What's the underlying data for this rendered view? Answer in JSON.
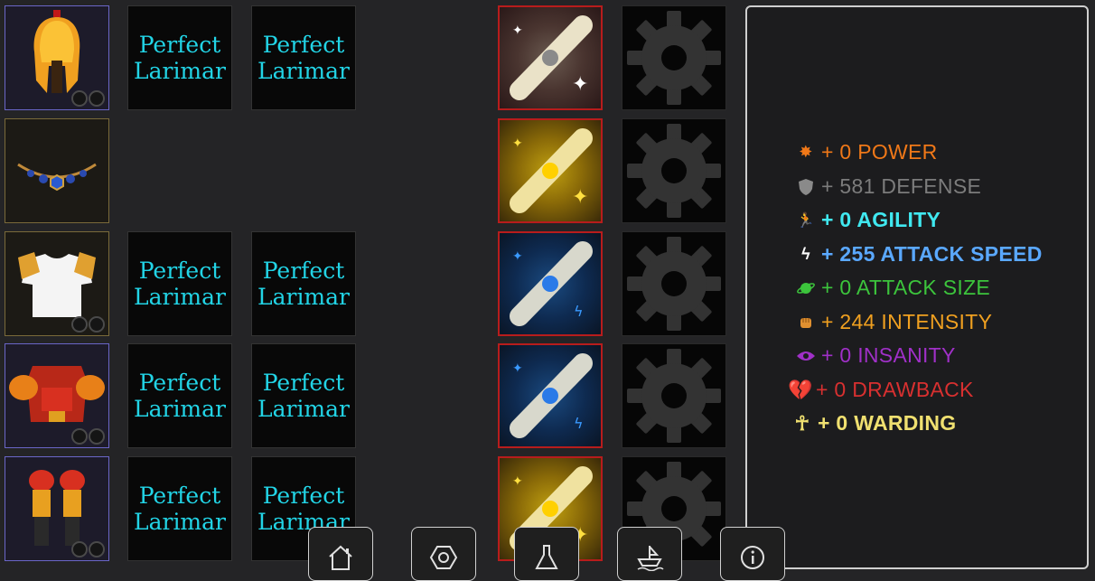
{
  "gear_rows": [
    {
      "item": "spartan-helmet",
      "gems": [
        "Perfect Larimar",
        "Perfect Larimar"
      ],
      "scroll": "silver"
    },
    {
      "item": "sapphire-necklace",
      "gems": [],
      "scroll": "gold"
    },
    {
      "item": "white-chest-tunic",
      "gems": [
        "Perfect Larimar",
        "Perfect Larimar"
      ],
      "scroll": "blue"
    },
    {
      "item": "red-gold-armor",
      "gems": [
        "Perfect Larimar",
        "Perfect Larimar"
      ],
      "scroll": "blue"
    },
    {
      "item": "red-gold-greaves",
      "gems": [
        "Perfect Larimar",
        "Perfect Larimar"
      ],
      "scroll": "gold"
    }
  ],
  "gem_labels": {
    "r0a": "Perfect Larimar",
    "r0b": "Perfect Larimar",
    "r2a": "Perfect Larimar",
    "r2b": "Perfect Larimar",
    "r3a": "Perfect Larimar",
    "r3b": "Perfect Larimar",
    "r4a": "Perfect Larimar",
    "r4b": "Perfect Larimar"
  },
  "stats": {
    "power": {
      "text": "+ 0 POWER",
      "icon": "burst-icon",
      "color": "#f07818"
    },
    "defense": {
      "text": "+ 581 DEFENSE",
      "icon": "shield-icon",
      "color": "#7c7c7c"
    },
    "agility": {
      "text": "+ 0 AGILITY",
      "icon": "runner-icon",
      "color": "#40e8f0"
    },
    "attack_speed": {
      "text": "+ 255 ATTACK SPEED",
      "icon": "lightning-icon",
      "color": "#5aa8ff"
    },
    "attack_size": {
      "text": "+ 0 ATTACK SIZE",
      "icon": "planet-icon",
      "color": "#3cc43c"
    },
    "intensity": {
      "text": "+ 244 INTENSITY",
      "icon": "fist-icon",
      "color": "#f0a020"
    },
    "insanity": {
      "text": "+ 0 INSANITY",
      "icon": "eye-icon",
      "color": "#a030c8"
    },
    "drawback": {
      "text": "+ 0 DRAWBACK",
      "icon": "broken-heart-icon",
      "color": "#d83030"
    },
    "warding": {
      "text": "+ 0 WARDING",
      "icon": "ankh-icon",
      "color": "#f0e070"
    }
  },
  "nav": [
    "home-icon",
    "hexagon-icon",
    "flask-icon",
    "ship-icon",
    "info-icon"
  ]
}
